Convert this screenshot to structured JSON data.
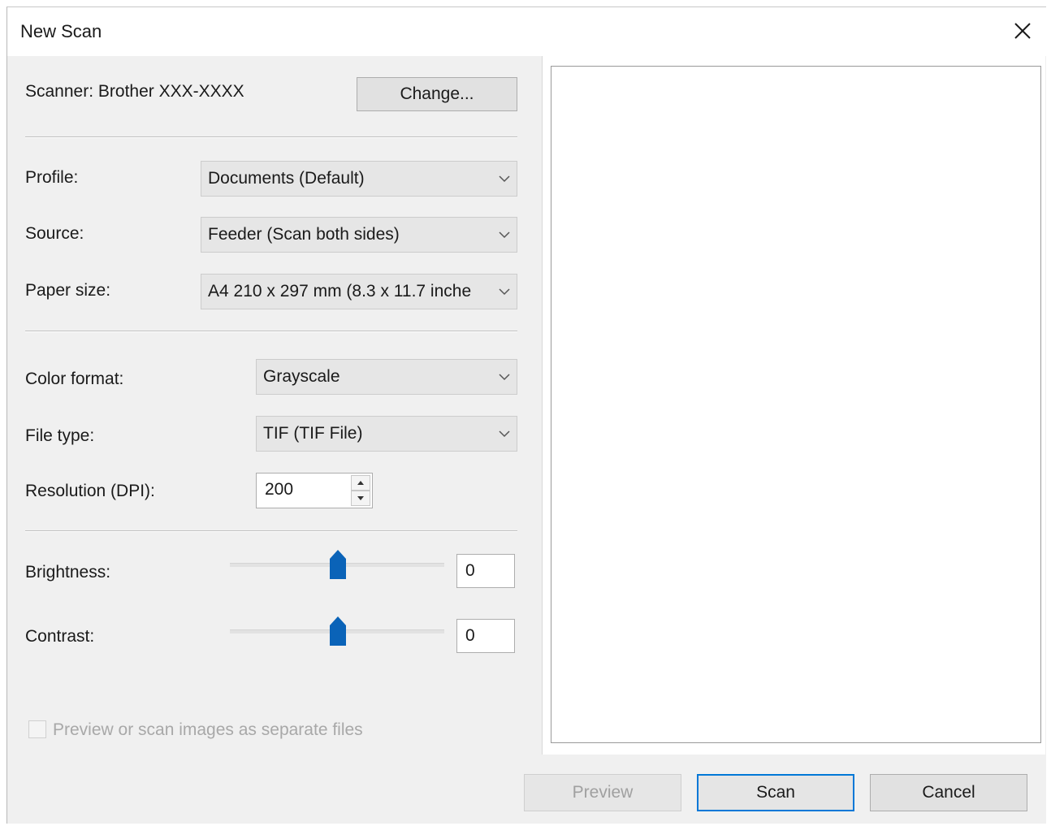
{
  "window": {
    "title": "New Scan"
  },
  "scanner": {
    "label": "Scanner: Brother XXX-XXXX",
    "change_button": "Change..."
  },
  "profile": {
    "label": "Profile:",
    "value": "Documents (Default)"
  },
  "source": {
    "label": "Source:",
    "value": "Feeder (Scan both sides)"
  },
  "paper_size": {
    "label": "Paper size:",
    "value": "A4 210 x 297 mm (8.3 x 11.7 inche"
  },
  "color_format": {
    "label": "Color format:",
    "value": "Grayscale"
  },
  "file_type": {
    "label": "File type:",
    "value": "TIF (TIF File)"
  },
  "resolution": {
    "label": "Resolution (DPI):",
    "value": "200"
  },
  "brightness": {
    "label": "Brightness:",
    "value": "0"
  },
  "contrast": {
    "label": "Contrast:",
    "value": "0"
  },
  "separate_files": {
    "label": "Preview or scan images as separate files",
    "checked": false,
    "enabled": false
  },
  "buttons": {
    "preview": "Preview",
    "scan": "Scan",
    "cancel": "Cancel"
  },
  "icons": {
    "close": "close-icon",
    "dropdown": "chevron-down-icon",
    "spin_up": "arrow-up-icon",
    "spin_down": "arrow-down-icon",
    "slider_thumb": "slider-thumb-icon"
  },
  "colors": {
    "accent": "#0078d7",
    "slider_thumb": "#0a63b8"
  }
}
